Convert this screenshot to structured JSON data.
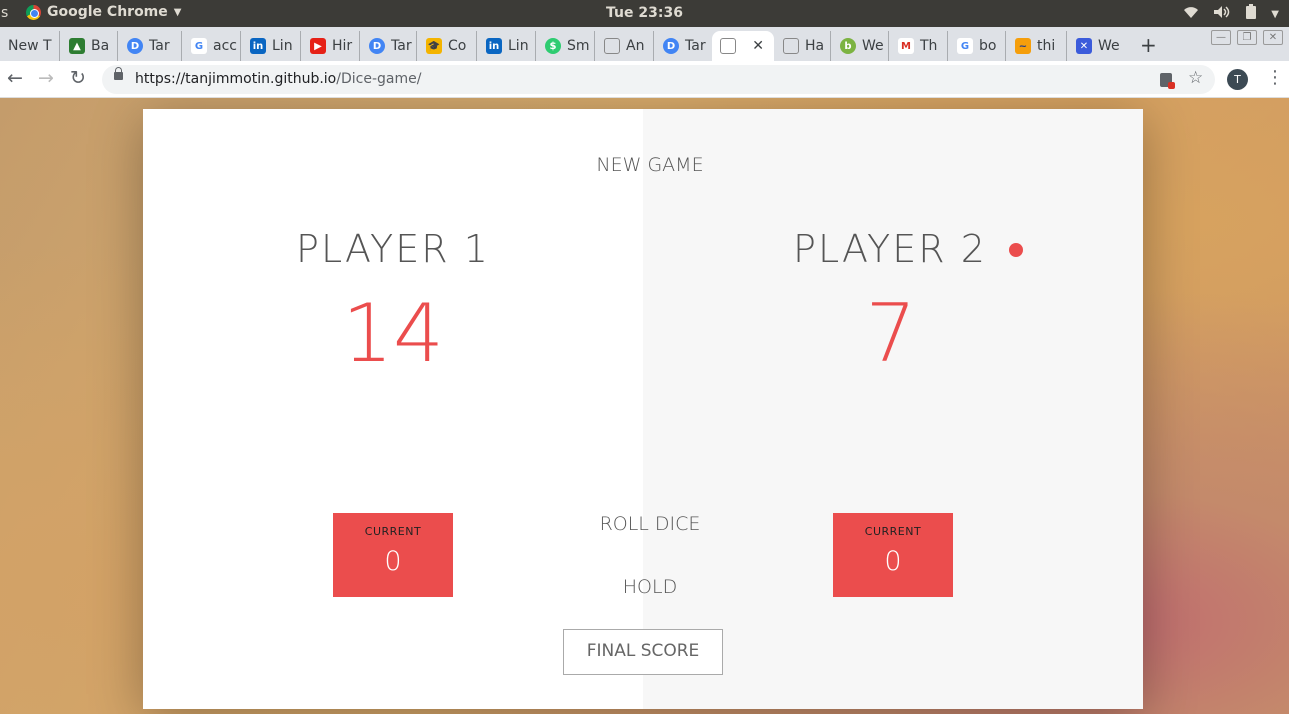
{
  "os": {
    "left_fragment": "s",
    "app_name": "Google Chrome",
    "clock": "Tue 23:36"
  },
  "tabs": [
    {
      "label": "New T",
      "favicon": "none",
      "color": "#dee1e6"
    },
    {
      "label": "Ba",
      "favicon": "android-icon",
      "color": "#2e7d32"
    },
    {
      "label": "Tar",
      "favicon": "discord-icon",
      "color": "#4285f4"
    },
    {
      "label": "acc",
      "favicon": "google-icon",
      "color": "#4285f4"
    },
    {
      "label": "Lin",
      "favicon": "linkedin-icon",
      "color": "#0a66c2"
    },
    {
      "label": "Hir",
      "favicon": "youtube-icon",
      "color": "#e62117"
    },
    {
      "label": "Tar",
      "favicon": "discord-icon",
      "color": "#4285f4"
    },
    {
      "label": "Co",
      "favicon": "graduation-cap-icon",
      "color": "#f4b400"
    },
    {
      "label": "Lin",
      "favicon": "linkedin-icon",
      "color": "#0a66c2"
    },
    {
      "label": "Sm",
      "favicon": "dollar-icon",
      "color": "#2ecc71"
    },
    {
      "label": "An",
      "favicon": "page-icon",
      "color": "#888888"
    },
    {
      "label": "Tar",
      "favicon": "discord-icon",
      "color": "#4285f4"
    },
    {
      "label": "",
      "favicon": "page-icon",
      "color": "#888888"
    },
    {
      "label": "Ha",
      "favicon": "page-icon",
      "color": "#888888"
    },
    {
      "label": "We",
      "favicon": "greenleaf-icon",
      "color": "#7cb342"
    },
    {
      "label": "Th",
      "favicon": "gmail-icon",
      "color": "#d93025"
    },
    {
      "label": "bo",
      "favicon": "google-icon",
      "color": "#4285f4"
    },
    {
      "label": "thi",
      "favicon": "wave-icon",
      "color": "#f59e0b"
    },
    {
      "label": "We",
      "favicon": "puzzle-icon",
      "color": "#3b5bdb"
    }
  ],
  "toolbar": {
    "url_host": "https://tanjimmotin.github.io",
    "url_path": "/Dice-game/",
    "profile_initial": "T"
  },
  "game": {
    "new_game": "New game",
    "roll_dice": "Roll dice",
    "hold": "Hold",
    "final_score": "Final score",
    "accent_color": "#eb4d4d",
    "active_player": 2,
    "players": [
      {
        "name": "Player 1",
        "score": "14",
        "current_label": "Current",
        "current": "0"
      },
      {
        "name": "Player 2",
        "score": "7",
        "current_label": "Current",
        "current": "0"
      }
    ]
  }
}
